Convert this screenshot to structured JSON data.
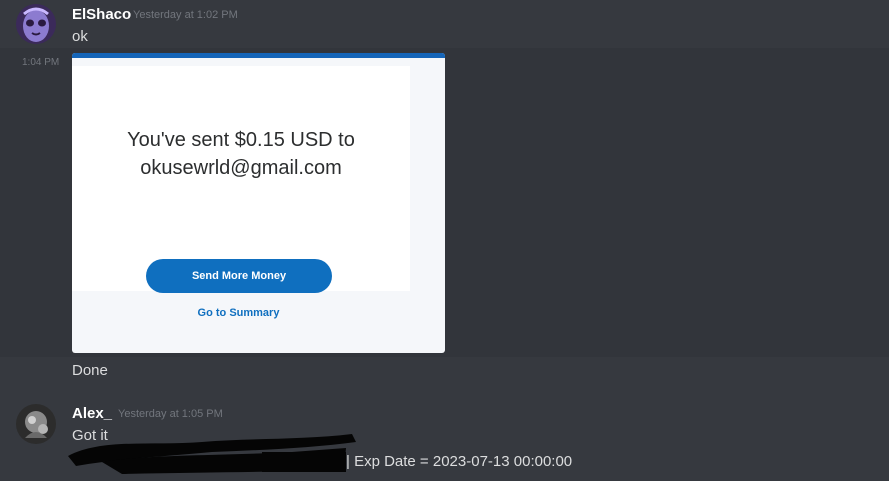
{
  "messages": [
    {
      "username": "ElShaco",
      "timestamp": "Yesterday at 1:02 PM",
      "text": "ok"
    },
    {
      "side_timestamp": "1:04 PM",
      "embed": {
        "sent_line1": "You've sent $0.15 USD to",
        "sent_line2": "okusewrld@gmail.com",
        "button_label": "Send More Money",
        "link_label": "Go to Summary"
      }
    },
    {
      "text": "Done"
    },
    {
      "username": "Alex_",
      "timestamp": "Yesterday at 1:05 PM",
      "text": "Got it",
      "text2": "| Exp Date = 2023-07-13 00:00:00"
    }
  ],
  "colors": {
    "background": "#36393f",
    "username": "#ffffff",
    "timestamp": "#72767d",
    "paypal_blue": "#0f6fbf"
  },
  "icons": [
    "avatar-elshaco",
    "avatar-alex"
  ]
}
